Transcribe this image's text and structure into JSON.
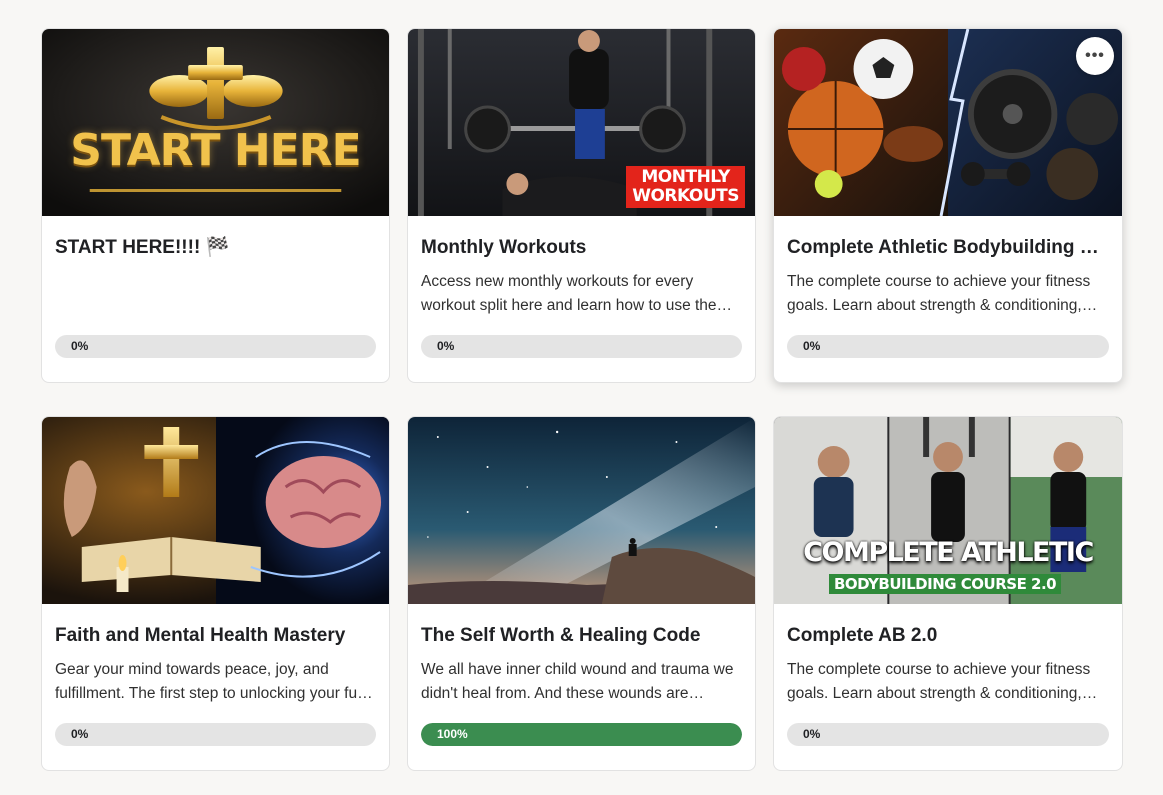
{
  "courses": [
    {
      "title": "START HERE!!!! 🏁",
      "description": "",
      "progress_label": "0%",
      "progress": 0,
      "thumb_text": "START HERE"
    },
    {
      "title": "Monthly Workouts",
      "description": "Access new monthly workouts for every workout split here and learn how to use the monthly workouts to reach your goals.",
      "progress_label": "0%",
      "progress": 0,
      "thumb_text_1": "MONTHLY",
      "thumb_text_2": "WORKOUTS"
    },
    {
      "title": "Complete Athletic Bodybuilding Course",
      "description": "The complete course to achieve your fitness goals. Learn about strength & conditioning, nutrition and more.",
      "progress_label": "0%",
      "progress": 0,
      "more_label": "•••"
    },
    {
      "title": "Faith and Mental Health Mastery",
      "description": "Gear your mind towards peace, joy, and fulfillment. The first step to unlocking your full potential.",
      "progress_label": "0%",
      "progress": 0
    },
    {
      "title": "The Self Worth & Healing Code",
      "description": "We all have inner child wound and trauma we didn't heal from. And these wounds are holding us back.",
      "progress_label": "100%",
      "progress": 100
    },
    {
      "title": "Complete AB 2.0",
      "description": "The complete course to achieve your fitness goals. Learn about strength & conditioning, nutrition and more.",
      "progress_label": "0%",
      "progress": 0,
      "thumb_text_1": "COMPLETE ATHLETIC",
      "thumb_text_2": "BODYBUILDING COURSE 2.0"
    }
  ],
  "colors": {
    "accent_green": "#3b8d50",
    "track": "#e4e4e4",
    "gold": "#e8b43a",
    "red_banner": "#e3241b"
  }
}
